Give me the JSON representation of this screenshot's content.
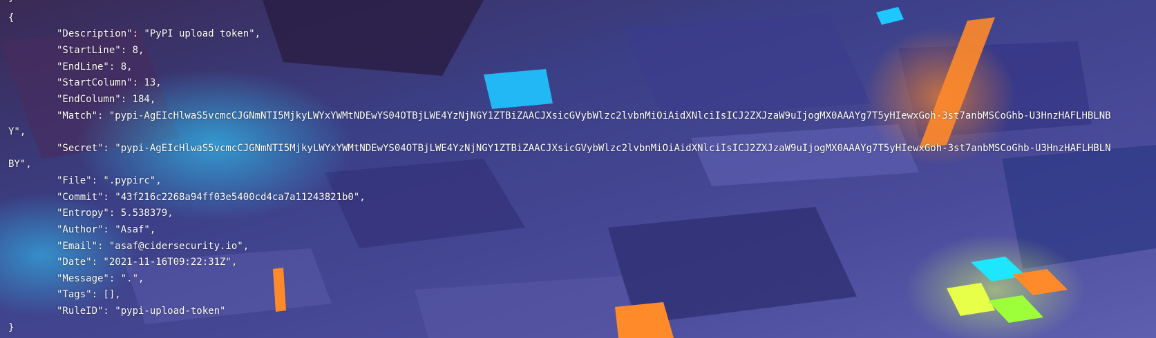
{
  "terminal": {
    "open_brace_top": "}",
    "open_brace": "{",
    "lines": [
      "\"Description\": \"PyPI upload token\",",
      "\"StartLine\": 8,",
      "\"EndLine\": 8,",
      "\"StartColumn\": 13,",
      "\"EndColumn\": 184,",
      "\"Match\": \"pypi-AgEIcHlwaS5vcmcCJGNmNTI5MjkyLWYxYWMtNDEwYS04OTBjLWE4YzNjNGY1ZTBiZAACJXsicGVybWlzc2lvbnMiOiAidXNlciIsICJ2ZXJzaW9uIjogMX0AAAYg7T5yHIewxGoh-3st7anbMSCoGhb-U3HnzHAFLHBLNB",
      "Y\",",
      "\"Secret\": \"pypi-AgEIcHlwaS5vcmcCJGNmNTI5MjkyLWYxYWMtNDEwYS04OTBjLWE4YzNjNGY1ZTBiZAACJXsicGVybWlzc2lvbnMiOiAidXNlciIsICJ2ZXJzaW9uIjogMX0AAAYg7T5yHIewxGoh-3st7anbMSCoGhb-U3HnzHAFLHBLN",
      "BY\",",
      "\"File\": \".pypirc\",",
      "\"Commit\": \"43f216c2268a94ff03e5400cd4ca7a11243821b0\",",
      "\"Entropy\": 5.538379,",
      "\"Author\": \"Asaf\",",
      "\"Email\": \"asaf@cidersecurity.io\",",
      "\"Date\": \"2021-11-16T09:22:31Z\",",
      "\"Message\": \".\",",
      "\"Tags\": [],",
      "\"RuleID\": \"pypi-upload-token\""
    ],
    "close_brace": "}"
  },
  "colors": {
    "text": "#ffffff",
    "background": "#2b2f6e",
    "accent_cyan": "#1ec8ff",
    "accent_orange": "#ff8a2a"
  }
}
